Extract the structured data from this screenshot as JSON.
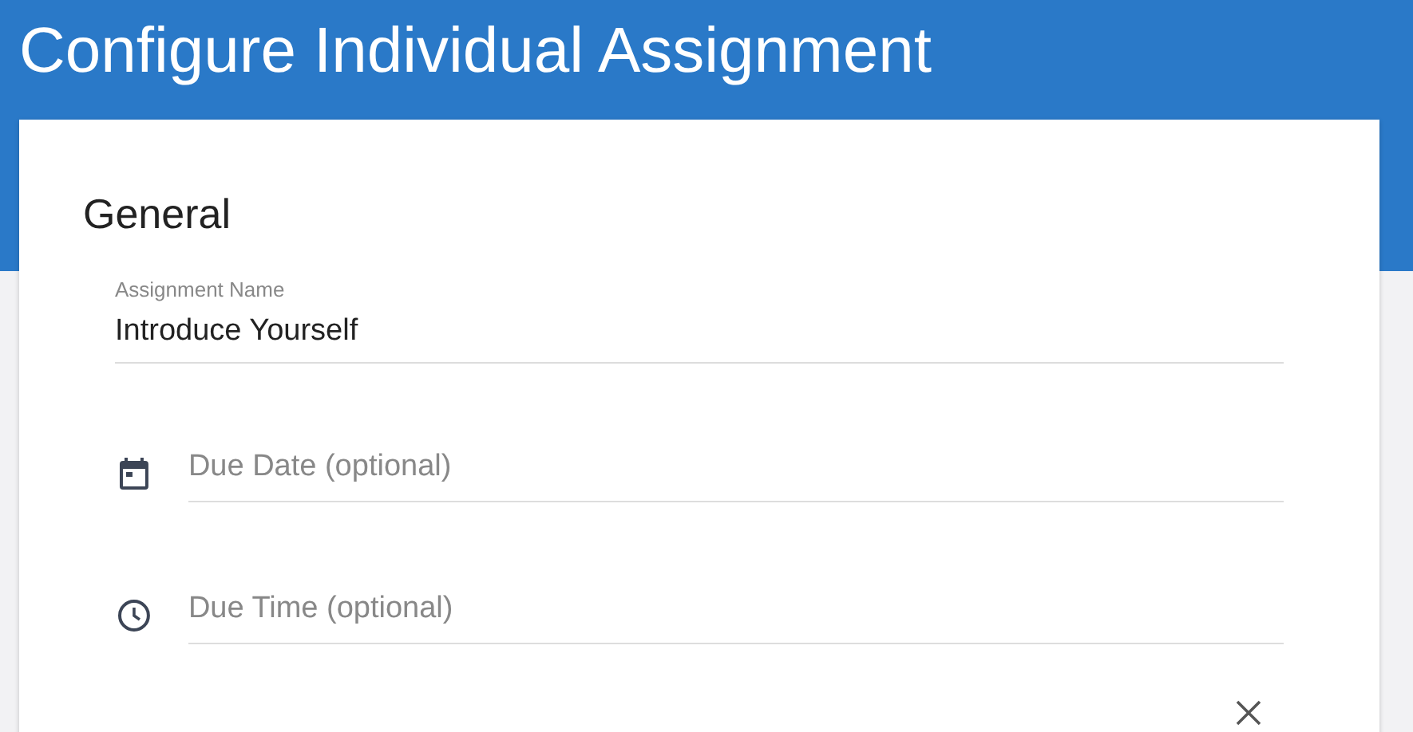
{
  "header": {
    "title": "Configure Individual Assignment"
  },
  "section": {
    "title": "General"
  },
  "fields": [
    {
      "kind": "text",
      "label": "Assignment Name",
      "value": "Introduce Yourself"
    },
    {
      "kind": "date",
      "placeholder": "Due Date (optional)"
    },
    {
      "kind": "time",
      "placeholder": "Due Time (optional)"
    }
  ]
}
